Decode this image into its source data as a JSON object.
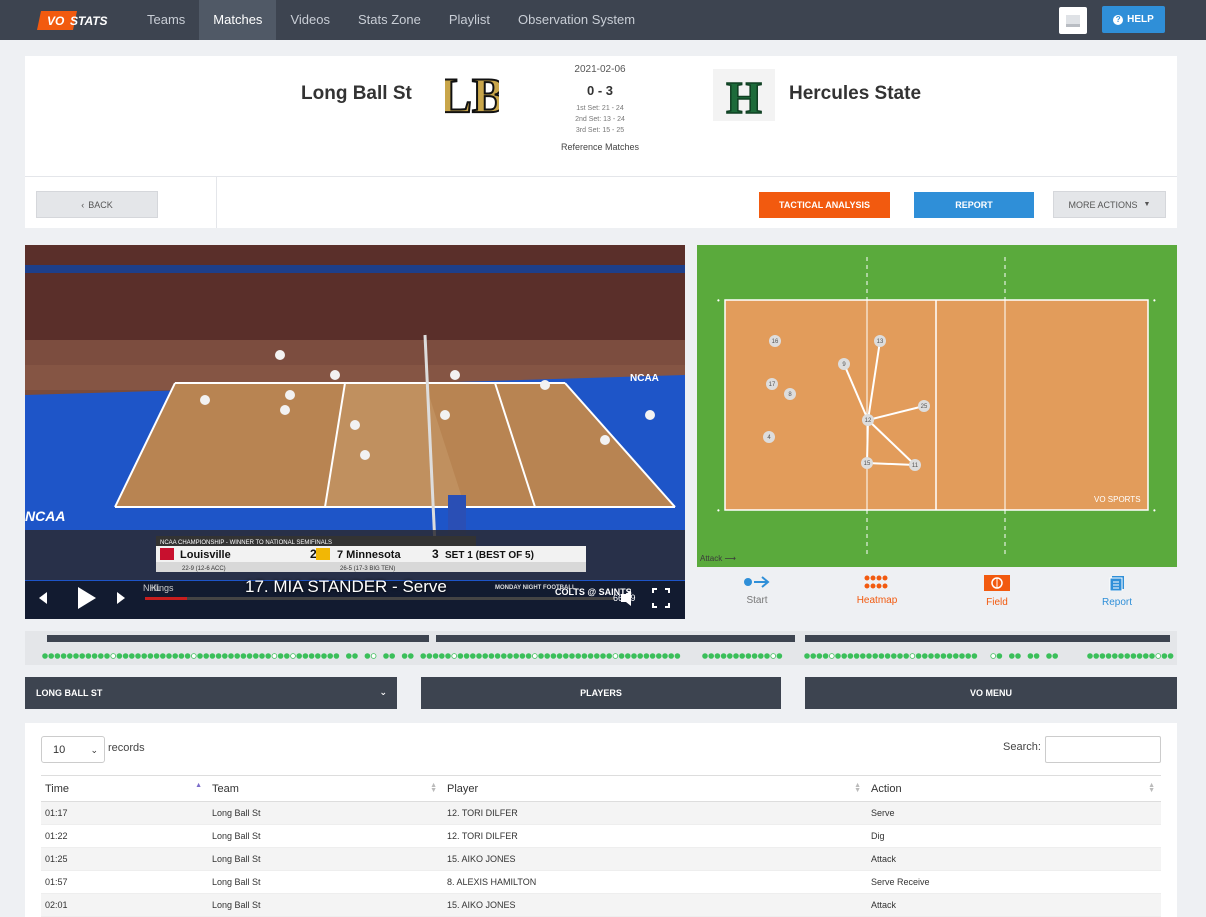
{
  "nav": {
    "logo_text": "VO STATS",
    "links": [
      "Teams",
      "Matches",
      "Videos",
      "Stats Zone",
      "Playlist",
      "Observation System"
    ],
    "active": "Matches",
    "help_label": "HELP"
  },
  "match": {
    "home_team": "Long Ball St",
    "away_team": "Hercules State",
    "date": "2021-02-06",
    "score": "0 - 3",
    "sets": [
      "1st Set: 21 - 24",
      "2nd Set: 13 - 24",
      "3rd Set: 15 - 25"
    ],
    "reference": "Reference Matches",
    "home_logo_text": "LB",
    "away_logo_text": "H"
  },
  "actions": {
    "back": "BACK",
    "tactical": "TACTICAL ANALYSIS",
    "report": "REPORT",
    "more": "MORE ACTIONS"
  },
  "video": {
    "caption": "17. MIA STANDER - Serve",
    "time": "66:09",
    "scorebug": {
      "header": "NCAA CHAMPIONSHIP - WINNER TO NATIONAL SEMIFINALS",
      "team1": "Louisville",
      "team1_score": "2",
      "team1_record": "22-9 (12-6 ACC)",
      "team2": "7 Minnesota",
      "team2_score": "3",
      "team2_record": "26-5 (17-3 BIG TEN)",
      "set": "SET 1 (BEST OF 5)"
    },
    "banner": {
      "court_text": "NCAA",
      "ticker_left": "NHL",
      "ticker_team": "Kings",
      "ticker_mnf": "MONDAY NIGHT FOOTBALL",
      "ticker_game": "COLTS @ SAINTS"
    }
  },
  "court": {
    "watermark": "VO SPORTS",
    "attack_label": "Attack",
    "players": [
      "16",
      "13",
      "9",
      "17",
      "8",
      "12",
      "25",
      "4",
      "15",
      "11"
    ]
  },
  "court_actions": [
    {
      "label": "Start",
      "icon": "start-icon"
    },
    {
      "label": "Heatmap",
      "icon": "heatmap-icon"
    },
    {
      "label": "Field",
      "icon": "field-icon"
    },
    {
      "label": "Report",
      "icon": "report-icon"
    }
  ],
  "selectors": {
    "team": "LONG BALL ST",
    "players": "PLAYERS",
    "vo_menu": "VO MENU"
  },
  "table": {
    "records_value": "10",
    "records_label": "records",
    "search_label": "Search:",
    "search_value": "",
    "columns": [
      "Time",
      "Team",
      "Player",
      "Action"
    ],
    "rows": [
      [
        "01:17",
        "Long Ball St",
        "12. TORI DILFER",
        "Serve"
      ],
      [
        "01:22",
        "Long Ball St",
        "12. TORI DILFER",
        "Dig"
      ],
      [
        "01:25",
        "Long Ball St",
        "15. AIKO JONES",
        "Attack"
      ],
      [
        "01:57",
        "Long Ball St",
        "8. ALEXIS HAMILTON",
        "Serve Receive"
      ],
      [
        "02:01",
        "Long Ball St",
        "15. AIKO JONES",
        "Attack"
      ]
    ]
  },
  "colors": {
    "nav_bg": "#3d4450",
    "accent_orange": "#f25a0f",
    "accent_blue": "#2f8fd8",
    "court_green": "#5aaa3c",
    "court_orange": "#e29c5b"
  }
}
